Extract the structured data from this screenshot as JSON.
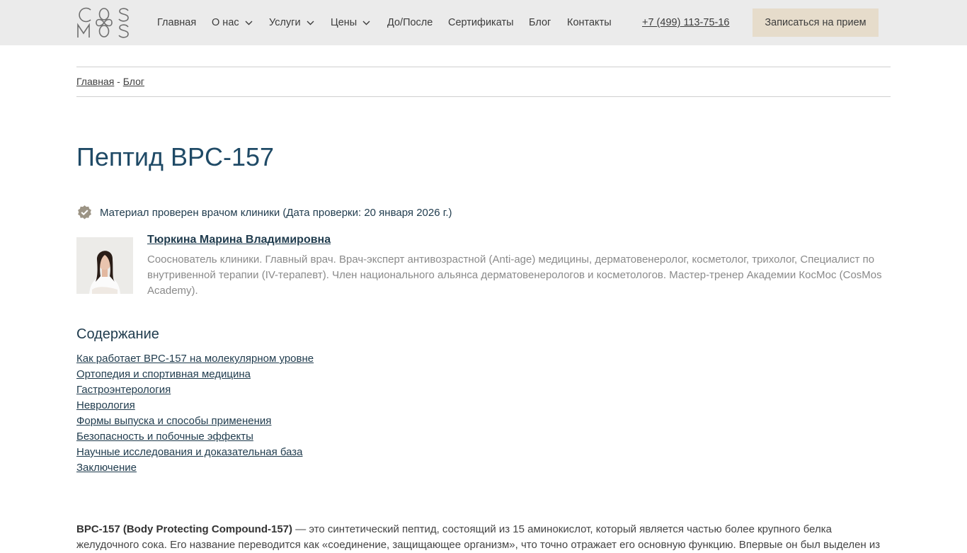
{
  "header": {
    "logo": {
      "top": "CS",
      "bottom": "MS",
      "alt": "CosMos"
    },
    "nav": [
      {
        "label": "Главная",
        "has_dropdown": false
      },
      {
        "label": "О нас",
        "has_dropdown": true
      },
      {
        "label": "Услуги",
        "has_dropdown": true
      },
      {
        "label": "Цены",
        "has_dropdown": true
      },
      {
        "label": "До/После",
        "has_dropdown": false
      },
      {
        "label": "Сертификаты",
        "has_dropdown": false
      },
      {
        "label": "Блог",
        "has_dropdown": false
      },
      {
        "label": "Контакты",
        "has_dropdown": false
      }
    ],
    "phone": "+7 (499) 113-75-16",
    "cta_label": "Записаться на прием"
  },
  "breadcrumb": {
    "home": "Главная",
    "separator": " - ",
    "current": "Блог"
  },
  "article": {
    "title": "Пептид BPC-157",
    "verified_text": "Материал проверен врачом клиники (Дата проверки: 20 января 2026 г.)",
    "author": {
      "name": "Тюркина Марина Владимировна",
      "bio": "Сооснователь клиники. Главный врач. Врач-эксперт антивозрастной (Anti-age) медицины, дерматовенеролог, косметолог, трихолог, Специалист по внутривенной терапии (IV-терапевт). Член национального альянса дерматовенерологов и косметологов. Мастер-тренер Академии КосМос (CosMos Academy)."
    },
    "toc": {
      "title": "Содержание",
      "items": [
        "Как работает BPC-157 на молекулярном уровне",
        "Ортопедия и спортивная медицина",
        "Гастроэнтерология",
        "Неврология",
        "Формы выпуска и способы применения",
        "Безопасность и побочные эффекты",
        "Научные исследования и доказательная база",
        "Заключение"
      ]
    },
    "intro_bold": "BPC-157 (Body Protecting Compound-157)",
    "intro_rest": " — это синтетический пептид, состоящий из 15 аминокислот, который является частью более крупного белка желудочного сока. Его название переводится как «соединение, защищающее организм», что точно отражает его основную функцию. Впервые он был выделен из"
  },
  "colors": {
    "header_bg": "#ebebeb",
    "cta_bg": "#e6dccb",
    "title": "#1f4a66",
    "link": "#1f3b4d",
    "badge": "#9c9485"
  }
}
